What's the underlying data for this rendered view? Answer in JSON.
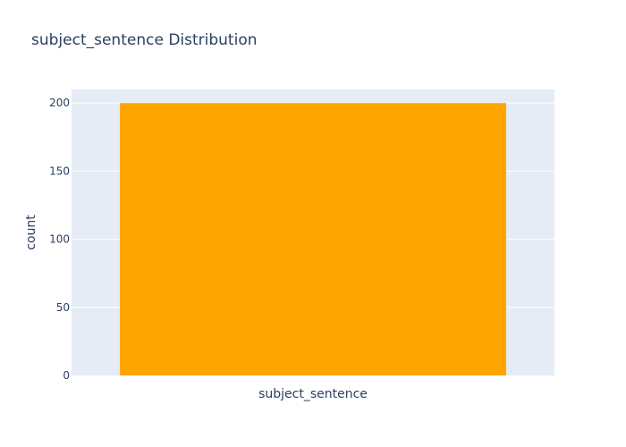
{
  "chart_data": {
    "type": "bar",
    "title": "subject_sentence Distribution",
    "xlabel": "",
    "ylabel": "count",
    "categories": [
      "subject_sentence"
    ],
    "values": [
      200
    ],
    "ylim": [
      0,
      210
    ],
    "yticks": [
      0,
      50,
      100,
      150,
      200
    ],
    "grid": true,
    "legend": "none",
    "colors": {
      "bar": "#FFA500",
      "plot_background": "#E5ECF6",
      "gridline": "#ffffff",
      "text": "#2a3f5f"
    }
  }
}
